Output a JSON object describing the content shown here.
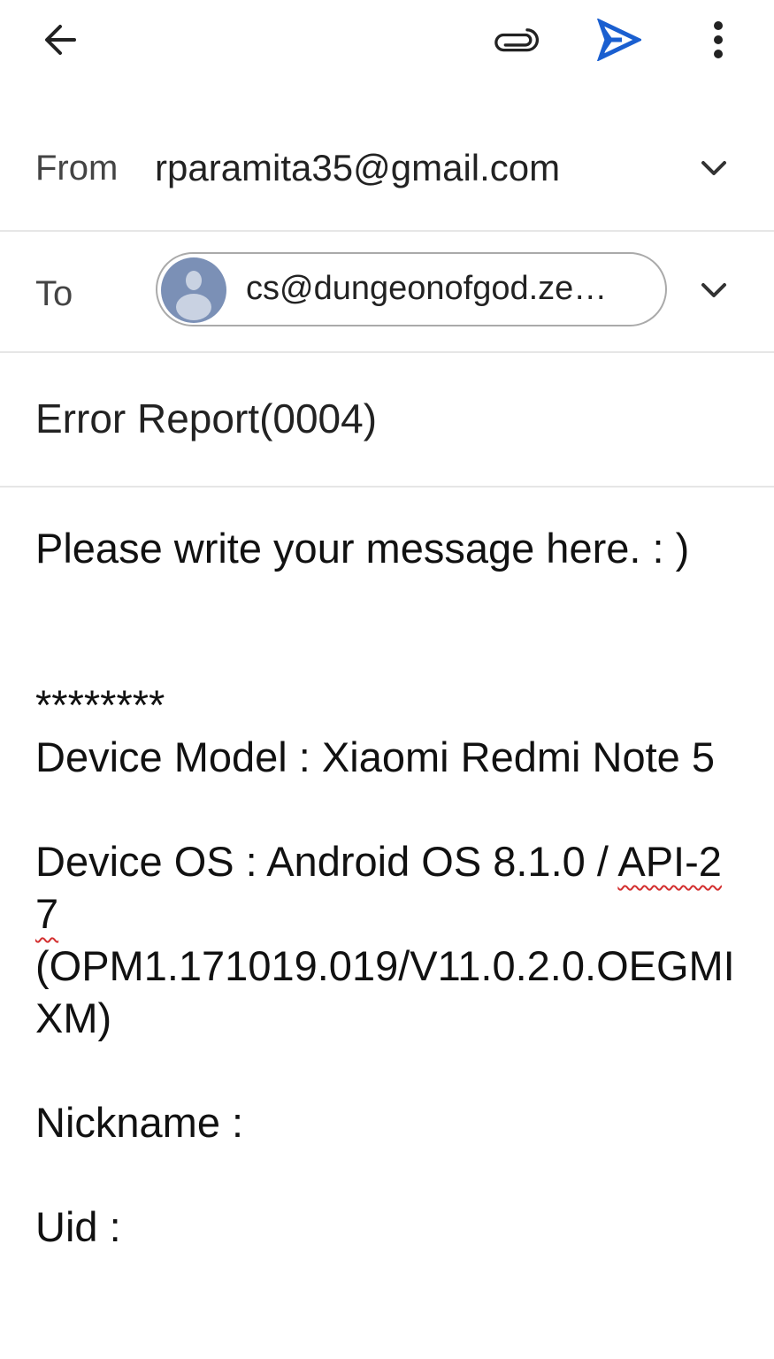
{
  "toolbar": {
    "back_icon": "arrow-back",
    "attach_icon": "paperclip",
    "send_icon": "send",
    "more_icon": "more-vertical",
    "send_color": "#1a5fd0"
  },
  "from": {
    "label": "From",
    "value": "rparamita35@gmail.com"
  },
  "to": {
    "label": "To",
    "recipient": "cs@dungeonofgod.ze…"
  },
  "subject": {
    "value": "Error Report(0004)"
  },
  "body": {
    "greeting": "Please write your message here. : )",
    "separator": "********",
    "device_model": "Device Model : Xiaomi Redmi Note 5",
    "device_os_prefix": "Device OS : Android OS 8.1.0 / ",
    "device_os_api": "API-27",
    "device_os_build": "(OPM1.171019.019/V11.0.2.0.OEGMIXM)",
    "nickname": "Nickname :",
    "uid": "Uid :"
  }
}
